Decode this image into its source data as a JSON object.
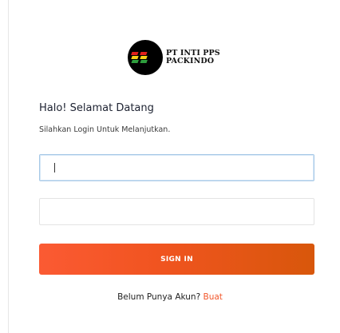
{
  "brand": {
    "name_line1": "PT INTI PPS",
    "name_line2": "PACKINDO",
    "logo_icon": "packindo-logo-icon",
    "logo_colors": [
      "#e2201b",
      "#f7d117",
      "#2e9e3c"
    ]
  },
  "login": {
    "title": "Halo! Selamat Datang",
    "subtitle": "Silahkan Login Untuk Melanjutkan.",
    "username": {
      "value": "",
      "placeholder": ""
    },
    "password": {
      "value": "",
      "placeholder": ""
    },
    "submit_label": "SIGN IN",
    "signup_prompt": "Belum Punya Akun?",
    "signup_link": "Buat"
  },
  "colors": {
    "accent": "#f2562a",
    "button_gradient_start": "#fb5a33",
    "button_gradient_end": "#d8570b",
    "focus_border": "#a6c8e6"
  }
}
